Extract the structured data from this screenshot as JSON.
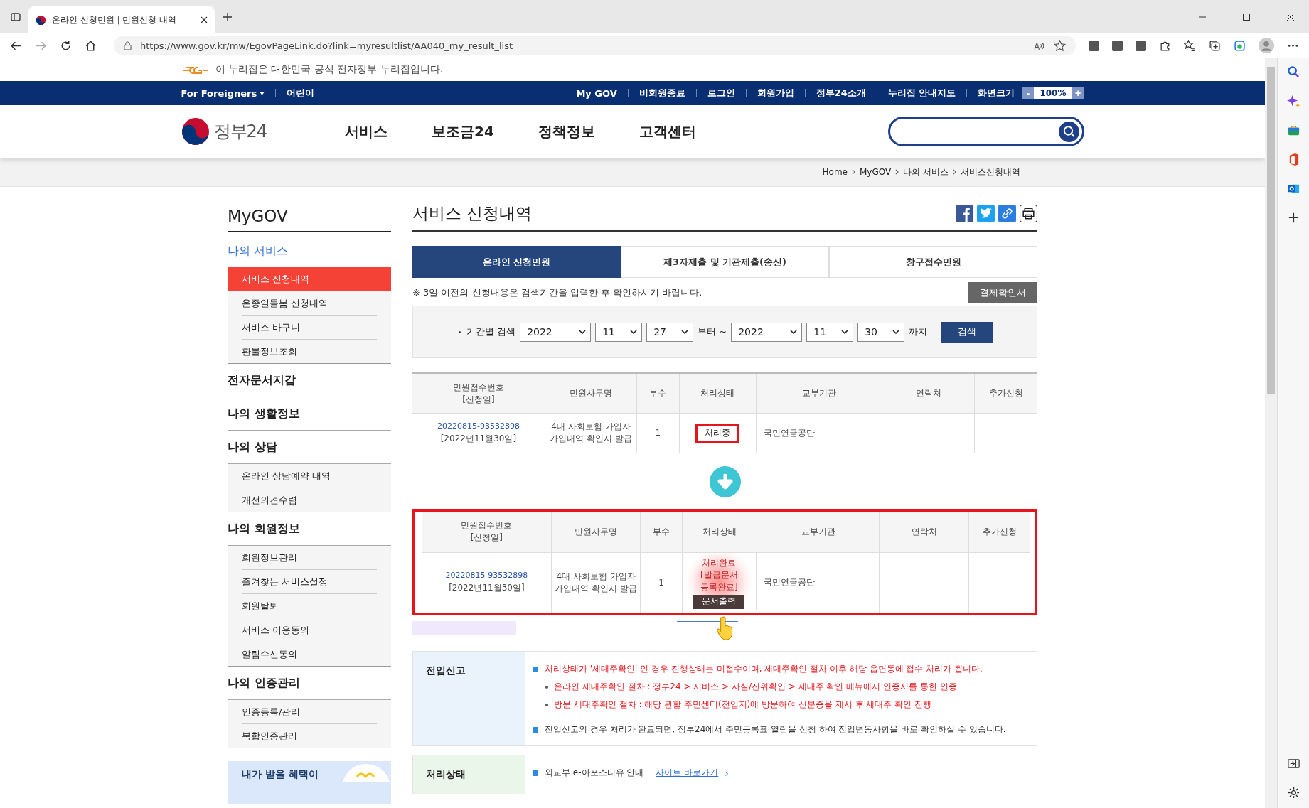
{
  "browser": {
    "tab_title": "온라인 신청민원 | 민원신청 내역",
    "url": "https://www.gov.kr/mw/EgovPageLink.do?link=myresultlist/AA040_my_result_list"
  },
  "gov_banner": "이 누리집은 대한민국 공식 전자정부 누리집입니다.",
  "top_nav": {
    "left": [
      "For Foreigners",
      "어린이"
    ],
    "right": [
      "My GOV",
      "비회원종료",
      "로그인",
      "회원가입",
      "정부24소개",
      "누리집 안내지도"
    ],
    "zoom_label": "화면크기",
    "zoom_minus": "-",
    "zoom_value": "100%",
    "zoom_plus": "+"
  },
  "header": {
    "logo": "정부24",
    "menu": [
      "서비스",
      "보조금24",
      "정책정보",
      "고객센터"
    ]
  },
  "breadcrumb": [
    "Home",
    "MyGOV",
    "나의 서비스",
    "서비스신청내역"
  ],
  "sidebar": {
    "title": "MyGOV",
    "sections": [
      {
        "title": "나의 서비스",
        "kind": "accent",
        "items": [
          {
            "label": "서비스 신청내역",
            "selected": true
          },
          {
            "label": "온종일돌봄 신청내역",
            "selected": false
          },
          {
            "label": "서비스 바구니",
            "selected": false
          },
          {
            "label": "환불정보조회",
            "selected": false
          }
        ]
      },
      {
        "title": "전자문서지갑",
        "kind": "plain"
      },
      {
        "title": "나의 생활정보",
        "kind": "plain"
      },
      {
        "title": "나의 상담",
        "kind": "plain",
        "items": [
          {
            "label": "온라인 상담예약 내역",
            "selected": false
          },
          {
            "label": "개선의견수렴",
            "selected": false
          }
        ]
      },
      {
        "title": "나의 회원정보",
        "kind": "plain",
        "items": [
          {
            "label": "회원정보관리",
            "selected": false
          },
          {
            "label": "즐겨찾는 서비스설정",
            "selected": false
          },
          {
            "label": "회원탈퇴",
            "selected": false
          },
          {
            "label": "서비스 이용동의",
            "selected": false
          },
          {
            "label": "알림수신동의",
            "selected": false
          }
        ]
      },
      {
        "title": "나의 인증관리",
        "kind": "plain",
        "items": [
          {
            "label": "인증등록/관리",
            "selected": false
          },
          {
            "label": "복합인증관리",
            "selected": false
          }
        ]
      }
    ],
    "promo": "내가 받을 혜택이"
  },
  "main": {
    "title": "서비스 신청내역",
    "tabs": [
      {
        "label": "온라인 신청민원",
        "selected": true
      },
      {
        "label": "제3자제출 및 기관제출(송신)",
        "selected": false
      },
      {
        "label": "창구접수민원",
        "selected": false
      }
    ],
    "notice": "※ 3일 이전의 신청내용은 검색기간을 입력한 후 확인하시기 바랍니다.",
    "receipt_button": "결제확인서",
    "filter": {
      "label": "기간별 검색",
      "from": [
        "2022",
        "11",
        "27"
      ],
      "from_suffix": "부터 ~",
      "to": [
        "2022",
        "11",
        "30"
      ],
      "to_suffix": "까지",
      "button": "검색"
    },
    "tables": [
      {
        "highlighted": false,
        "columns": [
          "민원접수번호\n[신청일]",
          "민원사무명",
          "부수",
          "처리상태",
          "교부기관",
          "연락처",
          "추가신청"
        ],
        "row": {
          "number": "20220815-93532898",
          "date": "[2022년11월30일]",
          "name": "4대 사회보험 가입자 가입내역 확인서 발급",
          "copies": "1",
          "status": {
            "kind": "in_progress",
            "text": "처리중"
          },
          "agency": "국민연금공단"
        }
      },
      {
        "highlighted": true,
        "columns": [
          "민원접수번호\n[신청일]",
          "민원사무명",
          "부수",
          "처리상태",
          "교부기관",
          "연락처",
          "추가신청"
        ],
        "row": {
          "number": "20220815-93532898",
          "date": "[2022년11월30일]",
          "name": "4대 사회보험 가입자 가입내역 확인서 발급",
          "copies": "1",
          "status": {
            "kind": "done",
            "text": "처리완료\n[발급문서\n등록완료]",
            "button": "문서출력"
          },
          "agency": "국민연금공단"
        }
      }
    ],
    "notes": [
      {
        "heading": "전입신고",
        "color": "#eaf2fb",
        "items": [
          {
            "kind": "warning",
            "text": "처리상태가 '세대주확인' 인 경우 진행상태는 미접수이며, 세대주확인 절차 이후 해당 읍면동에 접수 처리가 됩니다.",
            "children": [
              {
                "text": "온라인 세대주확인 절차 : 정부24 > 서비스 > 사실/진위확인 > 세대주 확인 메뉴에서 인증서를 통한 인증"
              },
              {
                "text": "방문 세대주확인 절차 : 해당 관할 주민센터(전입지)에 방문하여 신분증을 제시 후 세대주 확인 진행"
              }
            ]
          },
          {
            "kind": "normal",
            "text": "전입신고의 경우 처리가 완료되면, 정부24에서 주민등록표 열람을 신청 하여 전입변동사항을 바로 확인하실 수 있습니다."
          }
        ]
      },
      {
        "heading": "처리상태",
        "color": "#ebf6ea",
        "items": [
          {
            "kind": "normal",
            "text": "외교부 e-아포스티유 안내",
            "link": "사이트 바로가기",
            "link_arrow": "›"
          }
        ]
      }
    ]
  }
}
